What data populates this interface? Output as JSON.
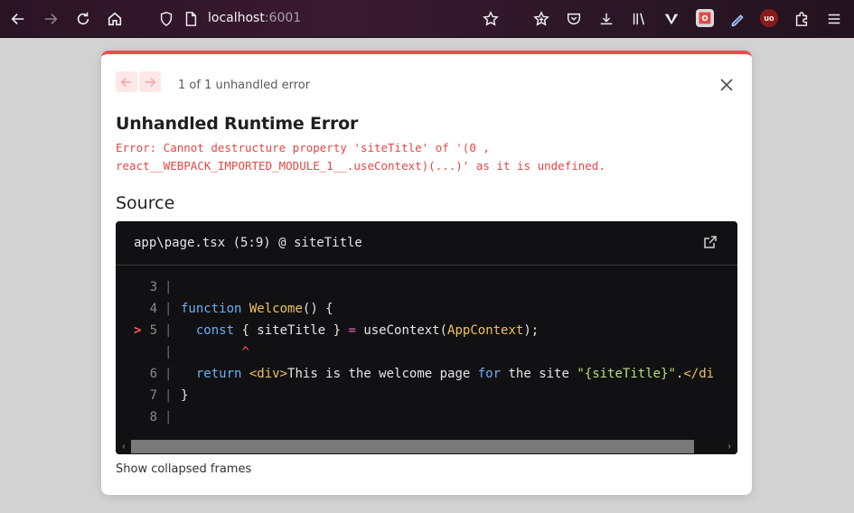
{
  "browser": {
    "url_host": "localhost",
    "url_port": ":6001",
    "extensions": [
      "vivaldi-icon",
      "puzzle-red-extension",
      "pen-extension",
      "ublock-origin-extension"
    ]
  },
  "dialog": {
    "error_count": "1 of 1 unhandled error",
    "title": "Unhandled Runtime Error",
    "message_line1": "Error: Cannot destructure property 'siteTitle' of '(0 ,",
    "message_line2": "react__WEBPACK_IMPORTED_MODULE_1__.useContext)(...)' as it is undefined.",
    "source_heading": "Source",
    "source_file": "app\\page.tsx (5:9) @ siteTitle",
    "show_collapsed": "Show collapsed frames",
    "accent_color": "#f04c4c"
  },
  "code": {
    "lines": [
      {
        "num": "3",
        "text": ""
      },
      {
        "num": "4",
        "text": "function Welcome() {"
      },
      {
        "num": "5",
        "text": "  const { siteTitle } = useContext(AppContext);",
        "marker": ">"
      },
      {
        "num": "",
        "text": "        ^"
      },
      {
        "num": "6",
        "text": "  return <div>This is the welcome page for the site \"{siteTitle}\".</di"
      },
      {
        "num": "7",
        "text": "}"
      },
      {
        "num": "8",
        "text": ""
      }
    ]
  }
}
